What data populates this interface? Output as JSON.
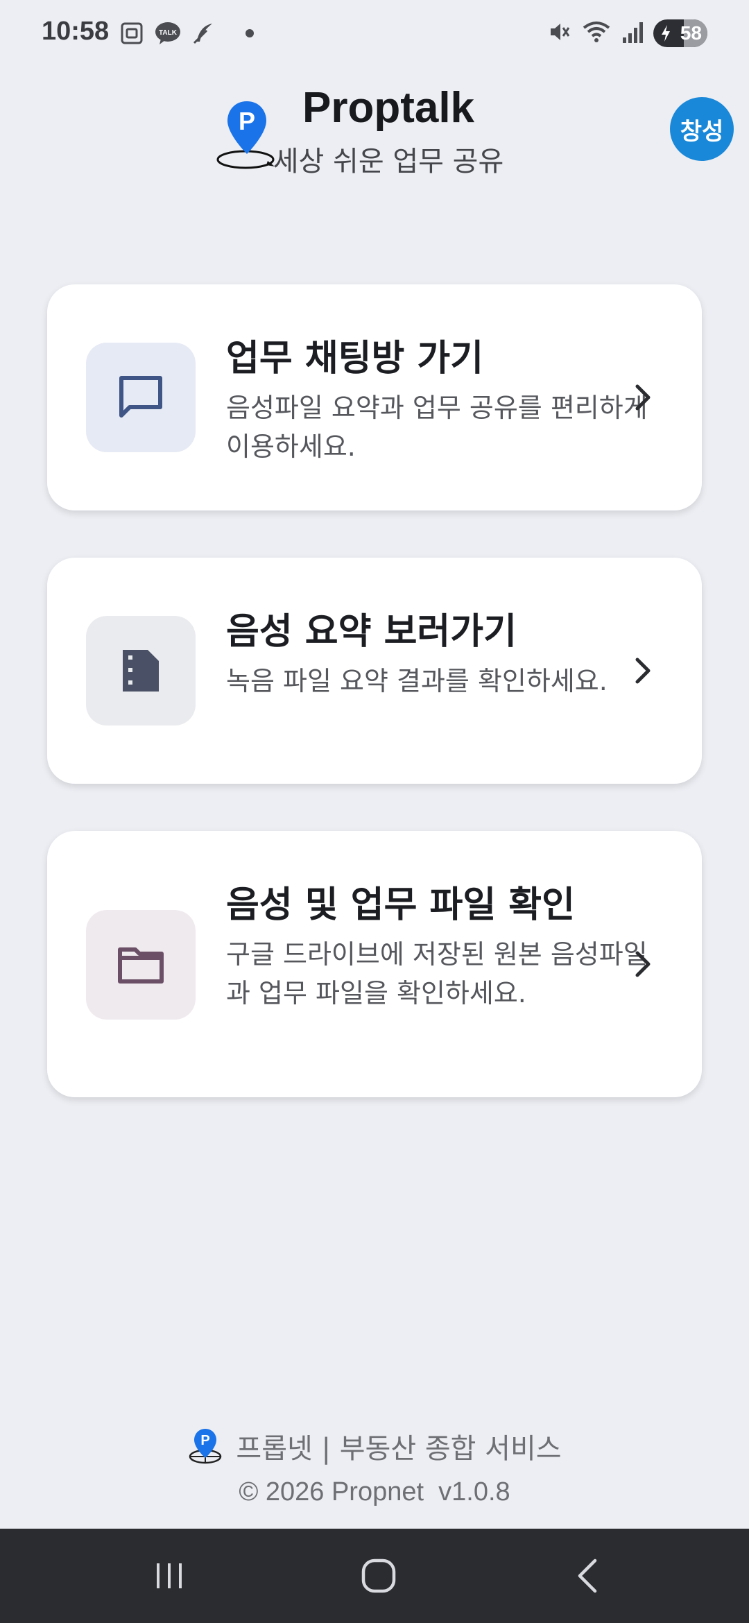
{
  "status_bar": {
    "time": "10:58",
    "battery": "58",
    "icons_left": [
      "screenshot-icon",
      "kakaotalk-icon",
      "feather-icon",
      "dot-icon"
    ],
    "icons_right": [
      "mute-icon",
      "wifi-icon",
      "signal-icon",
      "battery-icon"
    ]
  },
  "header": {
    "title": "Proptalk",
    "subtitle": "세상 쉬운 업무 공유",
    "avatar_label": "창성"
  },
  "cards": [
    {
      "title": "업무 채팅방 가기",
      "description": "음성파일 요약과 업무 공유를 편리하게 이용하세요.",
      "icon": "chat-icon",
      "icon_bg": "#e6eaf4",
      "icon_color": "#3f5585"
    },
    {
      "title": "음성 요약 보러가기",
      "description": "녹음 파일 요약 결과를 확인하세요.",
      "icon": "summary-document-icon",
      "icon_bg": "#eaebee",
      "icon_color": "#4a5166"
    },
    {
      "title": "음성 및 업무 파일 확인",
      "description": "구글 드라이브에 저장된 원본 음성파일과 업무 파일을 확인하세요.",
      "icon": "folder-icon",
      "icon_bg": "#efeaee",
      "icon_color": "#6a4f66"
    }
  ],
  "footer": {
    "brand": "프롭넷 | 부동산 종합 서비스",
    "copyright": "© 2026 Propnet  v1.0.8"
  },
  "colors": {
    "background": "#eceef3",
    "avatar": "#1a88d8",
    "logo_blue": "#1a73e8"
  }
}
